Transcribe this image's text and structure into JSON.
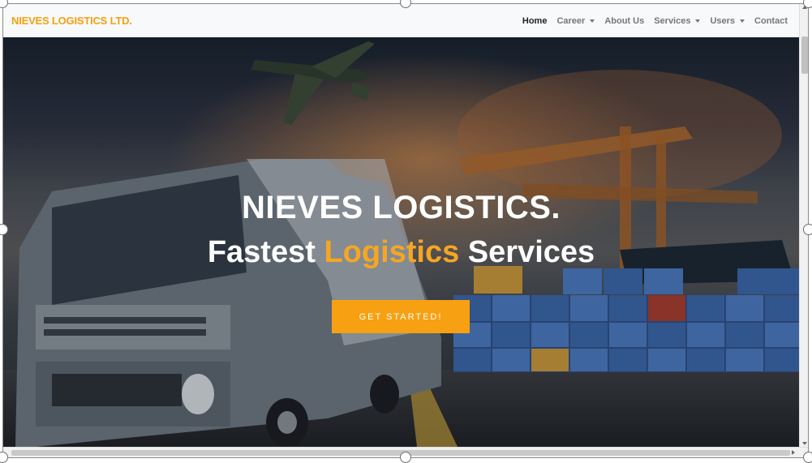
{
  "brand": "NIEVES LOGISTICS LTD.",
  "nav": {
    "home": "Home",
    "career": "Career",
    "about": "About Us",
    "services": "Services",
    "users": "Users",
    "contact": "Contact"
  },
  "hero": {
    "title": "NIEVES LOGISTICS.",
    "tagline_before": "Fastest ",
    "tagline_accent": "Logistics",
    "tagline_after": " Services",
    "cta": "GET STARTED!"
  },
  "colors": {
    "brand": "#f5a00f",
    "accent": "#f5a623",
    "cta": "#f7a012"
  }
}
